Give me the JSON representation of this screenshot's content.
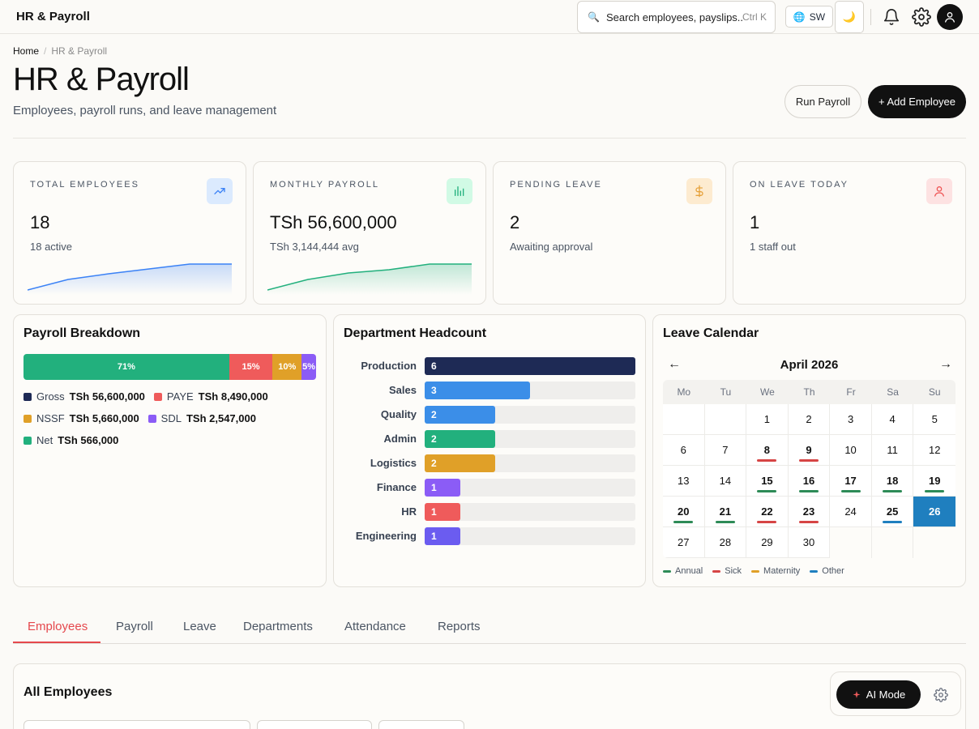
{
  "app": {
    "title": "HR & Payroll"
  },
  "topbar": {
    "search_placeholder": "Search employees, payslips...",
    "search_shortcut": "Ctrl K",
    "language": "SW",
    "icons": [
      "search-icon",
      "globe-icon",
      "moon-icon",
      "bell-icon",
      "gear-icon",
      "user-icon"
    ]
  },
  "breadcrumb": {
    "home": "Home",
    "current": "HR & Payroll"
  },
  "page": {
    "title": "HR & Payroll",
    "subtitle": "Employees, payroll runs, and leave management",
    "run_payroll": "Run Payroll",
    "add_employee": "+ Add Employee"
  },
  "stats": [
    {
      "label": "TOTAL EMPLOYEES",
      "value": "18",
      "sub": "18 active",
      "icon": "trend-up-icon",
      "color": "#3b82f6"
    },
    {
      "label": "MONTHLY PAYROLL",
      "value": "TSh 56,600,000",
      "sub": "TSh 3,144,444 avg",
      "icon": "bar-chart-icon",
      "color": "#22b07d"
    },
    {
      "label": "PENDING LEAVE",
      "value": "2",
      "sub": "Awaiting approval",
      "icon": "dollar-icon",
      "color": "#e6a23c"
    },
    {
      "label": "ON LEAVE TODAY",
      "value": "1",
      "sub": "1 staff out",
      "icon": "person-icon",
      "color": "#ef5555"
    }
  ],
  "payroll_breakdown": {
    "title": "Payroll Breakdown",
    "segments": [
      {
        "pct": 71,
        "label": "71%",
        "color": "#22b07d"
      },
      {
        "pct": 15,
        "label": "15%",
        "color": "#ef5b5b"
      },
      {
        "pct": 10,
        "label": "10%",
        "color": "#e0a028"
      },
      {
        "pct": 5,
        "label": "5%",
        "color": "#8b5cf6"
      }
    ],
    "legend": [
      {
        "name": "Gross",
        "value": "TSh 56,600,000",
        "color": "#1e2a55"
      },
      {
        "name": "PAYE",
        "value": "TSh 8,490,000",
        "color": "#ef5b5b"
      },
      {
        "name": "NSSF",
        "value": "TSh 5,660,000",
        "color": "#e0a028"
      },
      {
        "name": "SDL",
        "value": "TSh 2,547,000",
        "color": "#8b5cf6"
      },
      {
        "name": "Net",
        "value": "TSh 566,000",
        "color": "#22b07d"
      }
    ]
  },
  "headcount": {
    "title": "Department Headcount",
    "max": 6,
    "rows": [
      {
        "dept": "Production",
        "count": 6,
        "label": "6",
        "color": "#1e2a55"
      },
      {
        "dept": "Sales",
        "count": 3,
        "label": "3",
        "color": "#3b8ee8"
      },
      {
        "dept": "Quality",
        "count": 2,
        "label": "2",
        "color": "#3b8ee8"
      },
      {
        "dept": "Admin",
        "count": 2,
        "label": "2",
        "color": "#22b07d"
      },
      {
        "dept": "Logistics",
        "count": 2,
        "label": "2",
        "color": "#e0a028"
      },
      {
        "dept": "Finance",
        "count": 1,
        "label": "1",
        "color": "#8b5cf6"
      },
      {
        "dept": "HR",
        "count": 1,
        "label": "1",
        "color": "#ef5b5b"
      },
      {
        "dept": "Engineering",
        "count": 1,
        "label": "1",
        "color": "#6b5cf0"
      }
    ]
  },
  "calendar": {
    "title": "Leave Calendar",
    "prev": "←",
    "next": "→",
    "month": "April 2026",
    "weekdays": [
      "Mo",
      "Tu",
      "We",
      "Th",
      "Fr",
      "Sa",
      "Su"
    ],
    "lead_blanks": 2,
    "days": 30,
    "today": 26,
    "marks": {
      "8": "sick",
      "9": "sick",
      "15": "annual",
      "16": "annual",
      "17": "annual",
      "18": "annual",
      "19": "annual",
      "20": "annual",
      "21": "annual",
      "22": "sick",
      "23": "sick",
      "25": "other"
    },
    "bold_days": [
      8,
      9,
      15,
      16,
      17,
      18,
      19,
      20,
      21,
      22,
      23,
      25
    ],
    "legend": [
      {
        "name": "Annual",
        "key": "annual",
        "color": "#2e8b57"
      },
      {
        "name": "Sick",
        "key": "sick",
        "color": "#d64545"
      },
      {
        "name": "Maternity",
        "key": "maternity",
        "color": "#e0a028"
      },
      {
        "name": "Other",
        "key": "other",
        "color": "#1f7fbf"
      }
    ]
  },
  "tabs": [
    "Employees",
    "Payroll",
    "Leave",
    "Departments",
    "Attendance",
    "Reports"
  ],
  "employees_section": {
    "title": "All Employees"
  },
  "ai": {
    "label": "AI Mode"
  }
}
